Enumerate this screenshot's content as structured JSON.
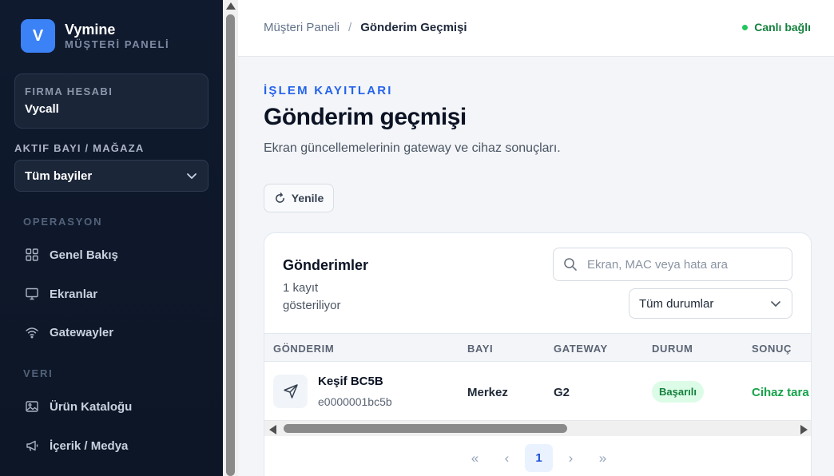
{
  "brand": {
    "logo_letter": "V",
    "name": "Vymine",
    "subtitle": "MÜŞTERİ PANELİ"
  },
  "account": {
    "label": "FIRMA HESABI",
    "value": "Vycall"
  },
  "dealer": {
    "label": "AKTIF BAYI / MAĞAZA",
    "selected": "Tüm bayiler"
  },
  "nav": {
    "section_ops": "OPERASYON",
    "section_data": "VERI",
    "items": [
      {
        "label": "Genel Bakış",
        "icon": "grid-icon"
      },
      {
        "label": "Ekranlar",
        "icon": "monitor-icon"
      },
      {
        "label": "Gatewayler",
        "icon": "wifi-icon"
      },
      {
        "label": "Ürün Kataloğu",
        "icon": "image-icon"
      },
      {
        "label": "İçerik / Medya",
        "icon": "megaphone-icon"
      }
    ]
  },
  "header": {
    "breadcrumb_root": "Müşteri Paneli",
    "breadcrumb_sep": "/",
    "breadcrumb_current": "Gönderim Geçmişi",
    "live_status": "Canlı bağlı",
    "live_color": "#22c55e"
  },
  "page": {
    "eyebrow": "İŞLEM KAYITLARI",
    "title": "Gönderim geçmişi",
    "description": "Ekran güncellemelerinin gateway ve cihaz sonuçları.",
    "refresh_label": "Yenile"
  },
  "card": {
    "title": "Gönderimler",
    "count_text": "1 kayıt gösteriliyor",
    "search_placeholder": "Ekran, MAC veya hata ara",
    "status_filter": "Tüm durumlar"
  },
  "table": {
    "headers": {
      "send": "GÖNDERIM",
      "dealer": "BAYI",
      "gateway": "GATEWAY",
      "status": "DURUM",
      "result": "SONUÇ"
    },
    "rows": [
      {
        "name": "Keşif BC5B",
        "mac": "e0000001bc5b",
        "dealer": "Merkez",
        "gateway": "G2",
        "status": "Başarılı",
        "result": "Cihaz tara"
      }
    ]
  },
  "pager": {
    "first": "«",
    "prev": "‹",
    "current": "1",
    "next": "›",
    "last": "»"
  },
  "colors": {
    "accent": "#2563eb",
    "sidebar_bg": "#101a2e",
    "success": "#16a34a"
  }
}
